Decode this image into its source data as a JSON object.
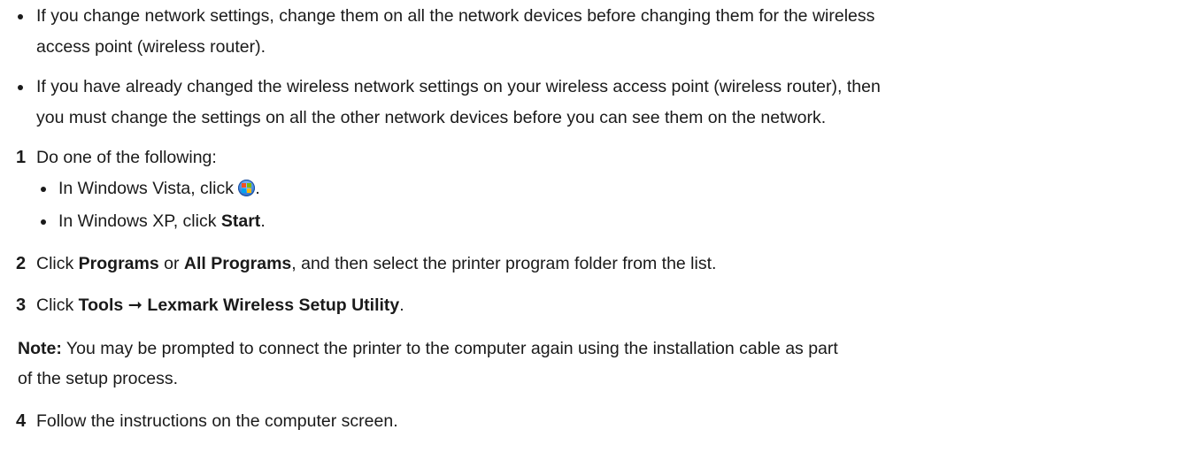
{
  "bullets": [
    {
      "line1": "If you change network settings, change them on all the network devices before changing them for the wireless",
      "line2": "access point (wireless router)."
    },
    {
      "line1": "If you have already changed the wireless network settings on your wireless access point (wireless router), then",
      "line2": "you must change the settings on all the other network devices before you can see them on the network."
    }
  ],
  "steps": {
    "s1": {
      "number": "1",
      "text": "Do one of the following:",
      "sub1_text": "In Windows Vista, click",
      "sub1_end": ".",
      "sub2_text": "In Windows XP, click",
      "sub2_bold": "Start",
      "sub2_end": "."
    },
    "s2": {
      "number": "2",
      "click": "Click",
      "bold1": "Programs",
      "or": "or",
      "bold2": "All Programs",
      "rest": ", and then select the printer program folder from the list."
    },
    "s3": {
      "number": "3",
      "click": "Click",
      "bold1": "Tools",
      "arrow": "➞",
      "bold2": "Lexmark Wireless Setup Utility",
      "end": "."
    },
    "note": {
      "label": "Note:",
      "line1": "You may be prompted to connect the printer to the computer again using the installation cable as part",
      "line2": "of the setup process."
    },
    "s4": {
      "number": "4",
      "text": "Follow the instructions on the computer screen."
    }
  },
  "icons": {
    "vista_start": "windows-vista-start-orb-icon"
  }
}
